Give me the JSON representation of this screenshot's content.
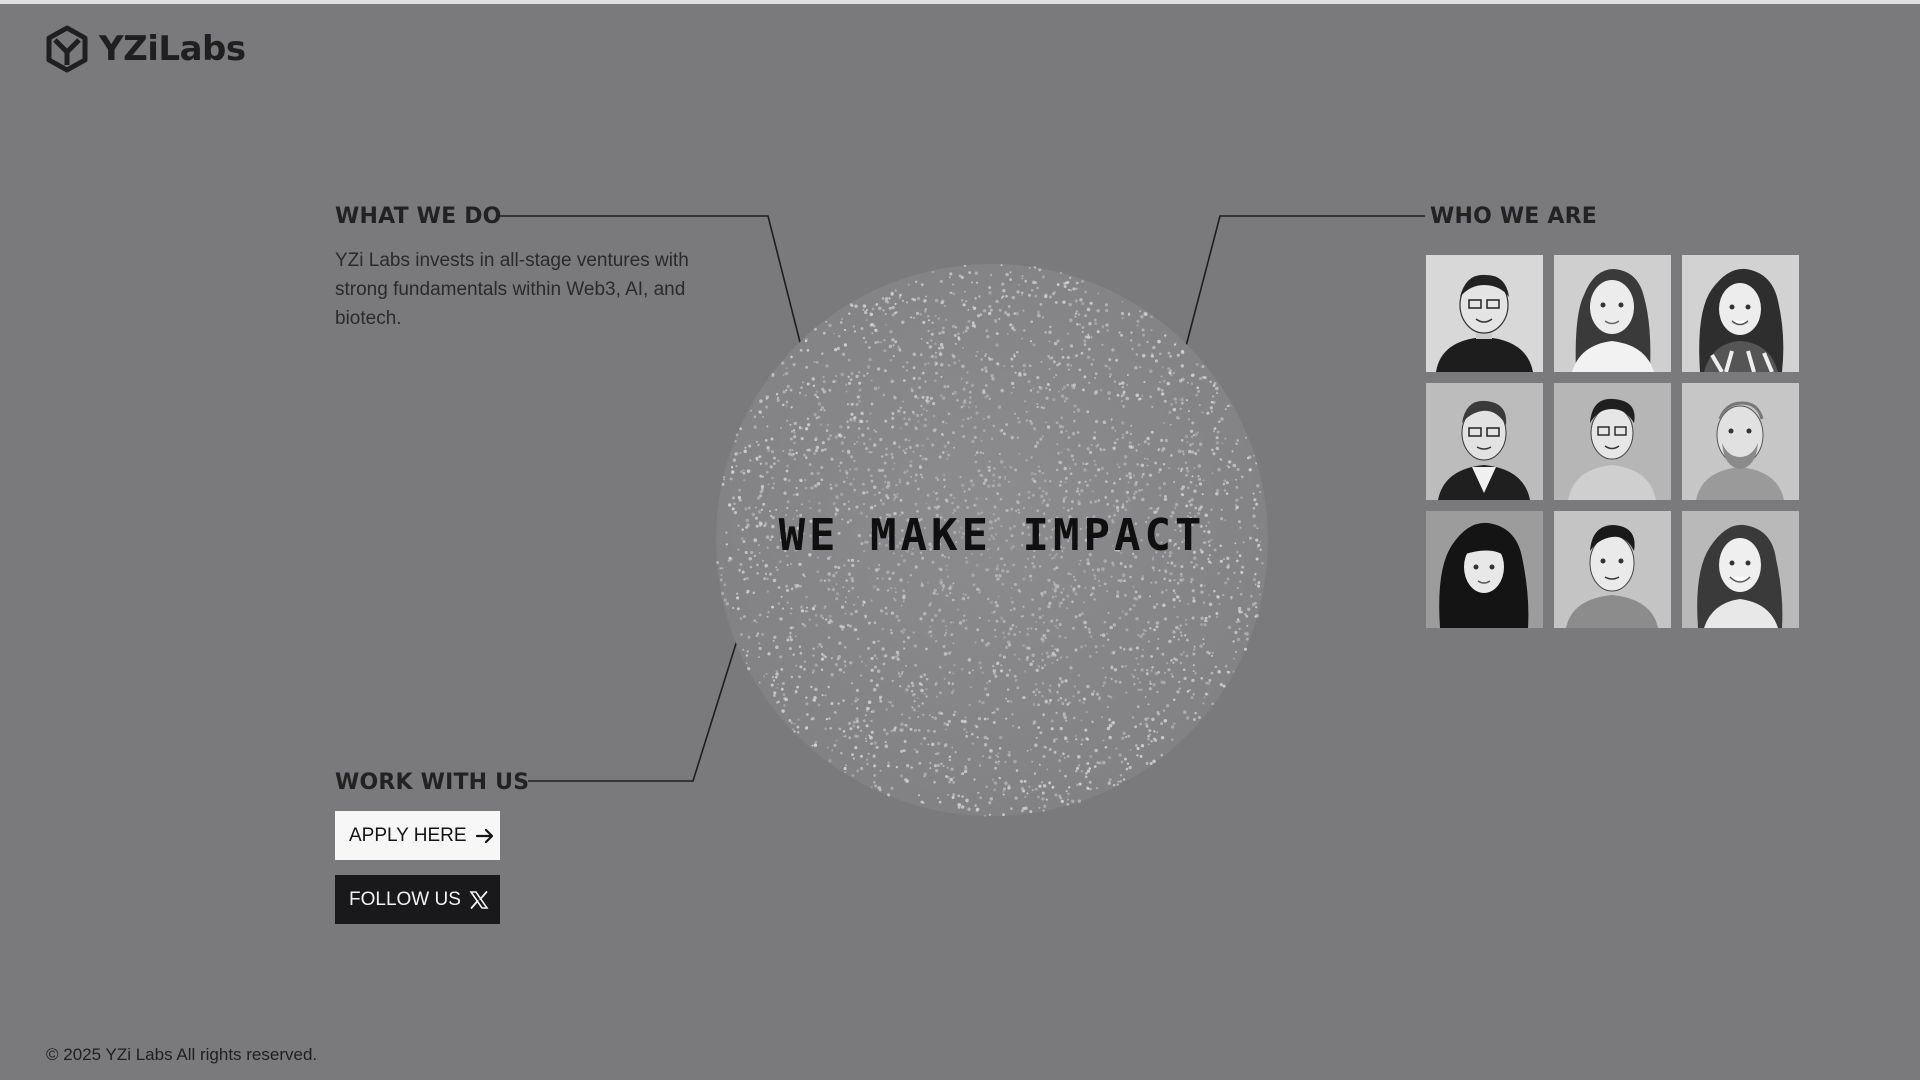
{
  "header": {
    "logo_text": "YZiLabs"
  },
  "what_we_do": {
    "title": "WHAT WE DO",
    "description": "YZi Labs invests in all-stage ventures with strong fundamentals within Web3, AI, and biotech."
  },
  "who_we_are": {
    "title": "WHO WE ARE",
    "portraits": [
      "portrait-1",
      "portrait-2",
      "portrait-3",
      "portrait-4",
      "portrait-5",
      "portrait-6",
      "portrait-7",
      "portrait-8",
      "portrait-9"
    ]
  },
  "hero": {
    "headline": "WE MAKE IMPACT"
  },
  "work_with_us": {
    "title": "WORK WITH US",
    "apply_label": "APPLY HERE",
    "follow_label": "FOLLOW US"
  },
  "footer": {
    "copyright": "© 2025 YZi Labs All rights reserved."
  },
  "colors": {
    "background": "#7a7a7c",
    "text_dark": "#222223",
    "apply_button_bg": "#f7f7f7",
    "follow_button_bg": "#19191b",
    "sphere_dots": "#d9d9d9"
  },
  "icons": {
    "logo": "yzilabs-logo-icon",
    "apply": "arrow-right-icon",
    "follow": "x-logo-icon"
  }
}
